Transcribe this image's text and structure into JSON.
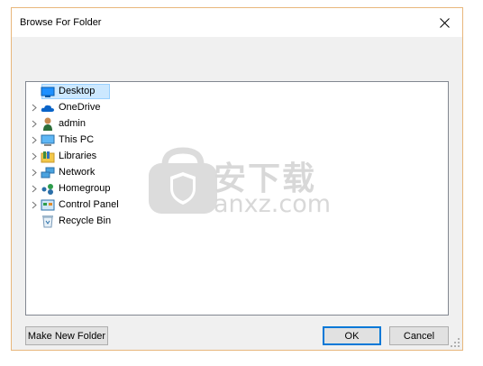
{
  "window": {
    "title": "Browse For Folder",
    "close_icon": "close-icon"
  },
  "tree": {
    "items": [
      {
        "label": "Desktop",
        "icon": "desktop-icon",
        "expandable": false,
        "selected": true
      },
      {
        "label": "OneDrive",
        "icon": "onedrive-icon",
        "expandable": true,
        "selected": false
      },
      {
        "label": "admin",
        "icon": "user-icon",
        "expandable": true,
        "selected": false
      },
      {
        "label": "This PC",
        "icon": "pc-icon",
        "expandable": true,
        "selected": false
      },
      {
        "label": "Libraries",
        "icon": "libraries-icon",
        "expandable": true,
        "selected": false
      },
      {
        "label": "Network",
        "icon": "network-icon",
        "expandable": true,
        "selected": false
      },
      {
        "label": "Homegroup",
        "icon": "homegroup-icon",
        "expandable": true,
        "selected": false
      },
      {
        "label": "Control Panel",
        "icon": "control-panel-icon",
        "expandable": true,
        "selected": false
      },
      {
        "label": "Recycle Bin",
        "icon": "recycle-bin-icon",
        "expandable": false,
        "selected": false
      }
    ]
  },
  "buttons": {
    "make_new_folder": "Make New Folder",
    "ok": "OK",
    "cancel": "Cancel"
  },
  "watermark": {
    "cn": "安下载",
    "latin": "anxz.com"
  },
  "colors": {
    "border_accent": "#e8b77c",
    "selection_bg": "#cce8ff",
    "selection_border": "#99d1ff",
    "default_button_border": "#0078d7"
  }
}
